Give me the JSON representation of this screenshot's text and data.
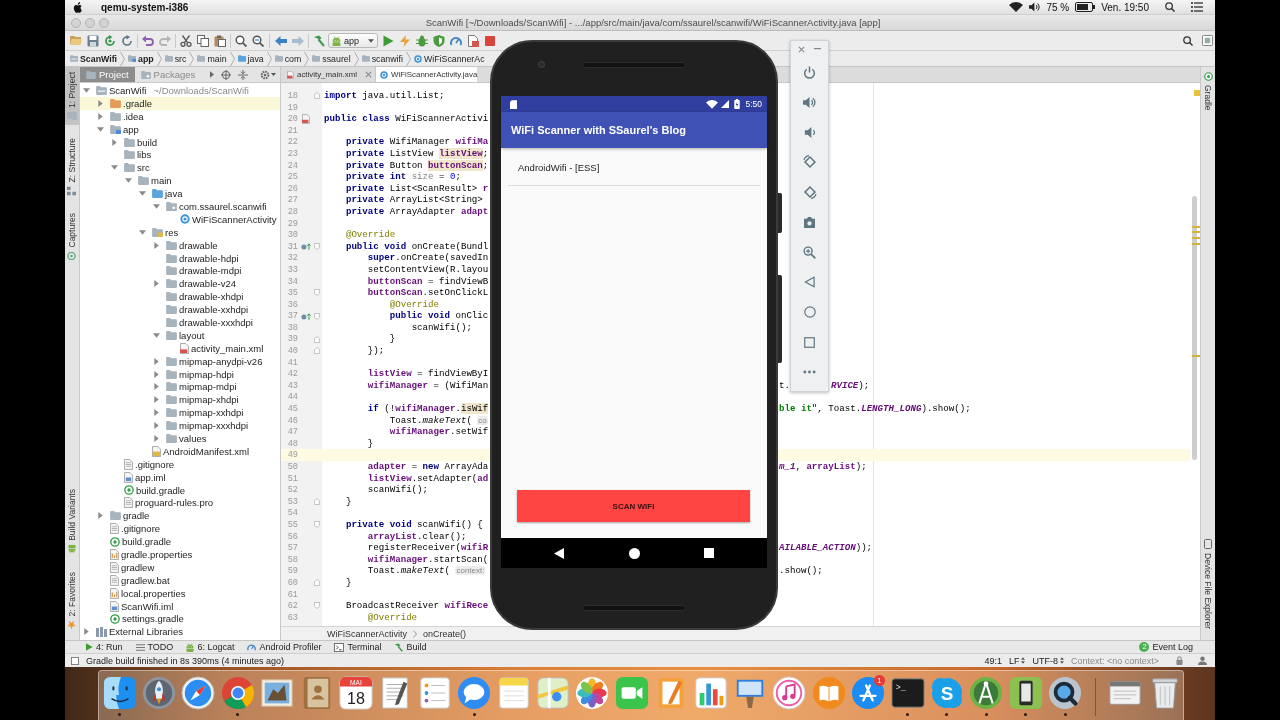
{
  "menubar": {
    "app_name": "qemu-system-i386",
    "battery": "75 %",
    "clock": "Ven. 19:50"
  },
  "window": {
    "title": "ScanWifi [~/Downloads/ScanWifi] - .../app/src/main/java/com/ssaurel/scanwifi/WiFiScannerActivity.java [app]"
  },
  "toolbar": {
    "run_config": "app"
  },
  "navbar": [
    {
      "label": "ScanWifi",
      "kind": "project"
    },
    {
      "label": "app",
      "kind": "module"
    },
    {
      "label": "src",
      "kind": "folder"
    },
    {
      "label": "main",
      "kind": "folder"
    },
    {
      "label": "java",
      "kind": "source"
    },
    {
      "label": "com",
      "kind": "folder"
    },
    {
      "label": "ssaurel",
      "kind": "folder"
    },
    {
      "label": "scanwifi",
      "kind": "folder"
    },
    {
      "label": "WiFiScannerAc",
      "kind": "class"
    }
  ],
  "left_tool_windows": {
    "top": [
      {
        "label": "1: Project",
        "kind": "project",
        "selected": true
      },
      {
        "label": "Z: Structure",
        "kind": "structure",
        "selected": false
      },
      {
        "label": "Captures",
        "kind": "captures",
        "selected": false
      }
    ],
    "bottom": [
      {
        "label": "Build Variants",
        "kind": "variants",
        "selected": false
      },
      {
        "label": "2: Favorites",
        "kind": "favorites",
        "selected": false
      }
    ]
  },
  "project_panel": {
    "tabs": [
      {
        "label": "Project",
        "selected": true
      },
      {
        "label": "Packages",
        "selected": false
      }
    ],
    "tree": [
      {
        "name": "ScanWifi",
        "path": "~/Downloads/ScanWifi",
        "kind": "project",
        "expanded": true,
        "highlighted": false,
        "children": [
          {
            "name": ".gradle",
            "kind": "folder-excluded",
            "expanded": false,
            "highlighted": true
          },
          {
            "name": ".idea",
            "kind": "folder",
            "expanded": false,
            "highlighted": false
          },
          {
            "name": "app",
            "kind": "module",
            "expanded": true,
            "highlighted": false,
            "children": [
              {
                "name": "build",
                "kind": "folder",
                "expanded": false,
                "highlighted": false
              },
              {
                "name": "libs",
                "kind": "folder",
                "highlighted": false
              },
              {
                "name": "src",
                "kind": "folder",
                "expanded": true,
                "highlighted": false,
                "children": [
                  {
                    "name": "main",
                    "kind": "folder",
                    "expanded": true,
                    "highlighted": false,
                    "children": [
                      {
                        "name": "java",
                        "kind": "folder-source",
                        "expanded": true,
                        "highlighted": false,
                        "children": [
                          {
                            "name": "com.ssaurel.scanwifi",
                            "kind": "package",
                            "expanded": true,
                            "highlighted": false,
                            "children": [
                              {
                                "name": "WiFiScannerActivity",
                                "kind": "class",
                                "highlighted": false
                              }
                            ]
                          }
                        ]
                      },
                      {
                        "name": "res",
                        "kind": "folder-res",
                        "expanded": true,
                        "highlighted": false,
                        "children": [
                          {
                            "name": "drawable",
                            "kind": "folder",
                            "expanded": false,
                            "highlighted": false
                          },
                          {
                            "name": "drawable-hdpi",
                            "kind": "folder",
                            "highlighted": false
                          },
                          {
                            "name": "drawable-mdpi",
                            "kind": "folder",
                            "highlighted": false
                          },
                          {
                            "name": "drawable-v24",
                            "kind": "folder",
                            "expanded": false,
                            "highlighted": false
                          },
                          {
                            "name": "drawable-xhdpi",
                            "kind": "folder",
                            "highlighted": false
                          },
                          {
                            "name": "drawable-xxhdpi",
                            "kind": "folder",
                            "highlighted": false
                          },
                          {
                            "name": "drawable-xxxhdpi",
                            "kind": "folder",
                            "highlighted": false
                          },
                          {
                            "name": "layout",
                            "kind": "folder",
                            "expanded": true,
                            "highlighted": false,
                            "children": [
                              {
                                "name": "activity_main.xml",
                                "kind": "layout-xml",
                                "highlighted": false
                              }
                            ]
                          },
                          {
                            "name": "mipmap-anydpi-v26",
                            "kind": "folder",
                            "expanded": false,
                            "highlighted": false
                          },
                          {
                            "name": "mipmap-hdpi",
                            "kind": "folder",
                            "expanded": false,
                            "highlighted": false
                          },
                          {
                            "name": "mipmap-mdpi",
                            "kind": "folder",
                            "expanded": false,
                            "highlighted": false
                          },
                          {
                            "name": "mipmap-xhdpi",
                            "kind": "folder",
                            "expanded": false,
                            "highlighted": false
                          },
                          {
                            "name": "mipmap-xxhdpi",
                            "kind": "folder",
                            "expanded": false,
                            "highlighted": false
                          },
                          {
                            "name": "mipmap-xxxhdpi",
                            "kind": "folder",
                            "expanded": false,
                            "highlighted": false
                          },
                          {
                            "name": "values",
                            "kind": "folder",
                            "expanded": false,
                            "highlighted": false
                          }
                        ]
                      },
                      {
                        "name": "AndroidManifest.xml",
                        "kind": "manifest",
                        "highlighted": false
                      }
                    ]
                  }
                ]
              },
              {
                "name": ".gitignore",
                "kind": "text-file",
                "highlighted": false
              },
              {
                "name": "app.iml",
                "kind": "iml",
                "highlighted": false
              },
              {
                "name": "build.gradle",
                "kind": "gradle",
                "highlighted": false
              },
              {
                "name": "proguard-rules.pro",
                "kind": "text-file",
                "highlighted": false
              }
            ]
          },
          {
            "name": "gradle",
            "kind": "folder",
            "expanded": false,
            "highlighted": false
          },
          {
            "name": ".gitignore",
            "kind": "text-file",
            "highlighted": false
          },
          {
            "name": "build.gradle",
            "kind": "gradle",
            "highlighted": false
          },
          {
            "name": "gradle.properties",
            "kind": "properties",
            "highlighted": false
          },
          {
            "name": "gradlew",
            "kind": "text-file",
            "highlighted": false
          },
          {
            "name": "gradlew.bat",
            "kind": "text-file",
            "highlighted": false
          },
          {
            "name": "local.properties",
            "kind": "properties",
            "highlighted": false
          },
          {
            "name": "ScanWifi.iml",
            "kind": "iml",
            "highlighted": false
          },
          {
            "name": "settings.gradle",
            "kind": "gradle",
            "highlighted": false
          }
        ]
      },
      {
        "name": "External Libraries",
        "kind": "libraries",
        "expanded": false,
        "highlighted": false
      }
    ]
  },
  "editor": {
    "tabs": [
      {
        "label": "activity_main.xml",
        "kind": "xml",
        "selected": false,
        "close_icon": true
      },
      {
        "label": "WiFiScannerActivity.java",
        "kind": "class",
        "selected": true,
        "close_icon": false
      }
    ],
    "lines": [
      {
        "number": "18",
        "current": false,
        "fold": {
          "kind": "end"
        },
        "code": [
          {
            "kind": "keyword",
            "text": "import"
          },
          {
            "kind": "plain",
            "text": " java.util.List;"
          }
        ]
      },
      {
        "number": "19",
        "current": false
      },
      {
        "number": "20",
        "current": false,
        "gutter": {
          "kind": "layout"
        },
        "code": [
          {
            "kind": "keyword",
            "text": "public class"
          },
          {
            "kind": "plain",
            "text": " WiFiScannerActivi"
          }
        ]
      },
      {
        "number": "21",
        "current": false
      },
      {
        "number": "22",
        "current": false,
        "code": [
          {
            "kind": "keyword",
            "text": "    private"
          },
          {
            "kind": "plain",
            "text": " WifiManager "
          },
          {
            "kind": "field",
            "text": "wifiMa"
          }
        ]
      },
      {
        "number": "23",
        "current": false,
        "code": [
          {
            "kind": "keyword",
            "text": "    private"
          },
          {
            "kind": "plain",
            "text": " ListView "
          },
          {
            "kind": "field-hl",
            "text": "listView"
          },
          {
            "kind": "plain",
            "text": ";"
          }
        ]
      },
      {
        "number": "24",
        "current": false,
        "code": [
          {
            "kind": "keyword",
            "text": "    private"
          },
          {
            "kind": "plain",
            "text": " Button "
          },
          {
            "kind": "field-hl",
            "text": "buttonScan"
          },
          {
            "kind": "plain",
            "text": ";"
          }
        ]
      },
      {
        "number": "25",
        "current": false,
        "code": [
          {
            "kind": "keyword",
            "text": "    private int "
          },
          {
            "kind": "unused",
            "text": "size"
          },
          {
            "kind": "plain",
            "text": " = "
          },
          {
            "kind": "number",
            "text": "0"
          },
          {
            "kind": "plain",
            "text": ";"
          }
        ]
      },
      {
        "number": "26",
        "current": false,
        "code": [
          {
            "kind": "keyword",
            "text": "    private"
          },
          {
            "kind": "plain",
            "text": " List<ScanResult> "
          },
          {
            "kind": "field",
            "text": "r"
          }
        ]
      },
      {
        "number": "27",
        "current": false,
        "code": [
          {
            "kind": "keyword",
            "text": "    private"
          },
          {
            "kind": "plain",
            "text": " ArrayList<String>"
          }
        ]
      },
      {
        "number": "28",
        "current": false,
        "code": [
          {
            "kind": "keyword",
            "text": "    private"
          },
          {
            "kind": "plain",
            "text": " ArrayAdapter "
          },
          {
            "kind": "field",
            "text": "adapt"
          }
        ]
      },
      {
        "number": "29",
        "current": false
      },
      {
        "number": "30",
        "current": false,
        "code": [
          {
            "kind": "annotation",
            "text": "    @Override"
          }
        ]
      },
      {
        "number": "31",
        "current": false,
        "gutter": {
          "kind": "override"
        },
        "fold": {
          "kind": "start"
        },
        "code": [
          {
            "kind": "keyword",
            "text": "    public void"
          },
          {
            "kind": "plain",
            "text": " onCreate(Bundl"
          }
        ]
      },
      {
        "number": "32",
        "current": false,
        "code": [
          {
            "kind": "keyword",
            "text": "        super"
          },
          {
            "kind": "plain",
            "text": ".onCreate(savedIn"
          }
        ]
      },
      {
        "number": "33",
        "current": false,
        "code": [
          {
            "kind": "plain",
            "text": "        setContentView(R.layou"
          }
        ]
      },
      {
        "number": "34",
        "current": false,
        "code": [
          {
            "kind": "field",
            "text": "        buttonScan"
          },
          {
            "kind": "plain",
            "text": " = findViewB"
          }
        ]
      },
      {
        "number": "35",
        "current": false,
        "fold": {
          "kind": "start"
        },
        "code": [
          {
            "kind": "field",
            "text": "        buttonScan"
          },
          {
            "kind": "plain",
            "text": ".setOnClickL"
          }
        ]
      },
      {
        "number": "36",
        "current": false,
        "code": [
          {
            "kind": "annotation",
            "text": "            @Override"
          }
        ]
      },
      {
        "number": "37",
        "current": false,
        "gutter": {
          "kind": "override"
        },
        "fold": {
          "kind": "start"
        },
        "code": [
          {
            "kind": "keyword",
            "text": "            public void"
          },
          {
            "kind": "plain",
            "text": " onClic"
          }
        ]
      },
      {
        "number": "38",
        "current": false,
        "code": [
          {
            "kind": "plain",
            "text": "                scanWifi();"
          }
        ]
      },
      {
        "number": "39",
        "current": false,
        "fold": {
          "kind": "end"
        },
        "code": [
          {
            "kind": "plain",
            "text": "            }"
          }
        ]
      },
      {
        "number": "40",
        "current": false,
        "fold": {
          "kind": "end"
        },
        "code": [
          {
            "kind": "plain",
            "text": "        });"
          }
        ]
      },
      {
        "number": "41",
        "current": false
      },
      {
        "number": "42",
        "current": false,
        "code": [
          {
            "kind": "field",
            "text": "        listView"
          },
          {
            "kind": "plain",
            "text": " = findViewByI"
          }
        ]
      },
      {
        "number": "43",
        "current": false,
        "code": [
          {
            "kind": "field",
            "text": "        wifiManager"
          },
          {
            "kind": "plain",
            "text": " = (WifiMan"
          }
        ],
        "right": [
          {
            "code": [
              {
                "kind": "plain",
                "text": "t."
              }
            ]
          },
          {
            "code": [
              {
                "kind": "constant",
                "text": "RVICE"
              },
              {
                "kind": "plain",
                "text": ");"
              }
            ]
          }
        ]
      },
      {
        "number": "44",
        "current": false
      },
      {
        "number": "45",
        "current": false,
        "code": [
          {
            "kind": "keyword",
            "text": "        if"
          },
          {
            "kind": "plain",
            "text": " (!"
          },
          {
            "kind": "field",
            "text": "wifiManager"
          },
          {
            "kind": "plain",
            "text": "."
          },
          {
            "kind": "method-hl",
            "text": "isWif"
          }
        ],
        "right": [
          {
            "code": [
              {
                "kind": "string",
                "text": "ble it\""
              },
              {
                "kind": "plain",
                "text": ", Toast."
              },
              {
                "kind": "constant",
                "text": "LENGTH_LONG"
              },
              {
                "kind": "plain",
                "text": ").show();"
              }
            ]
          }
        ]
      },
      {
        "number": "46",
        "current": false,
        "code": [
          {
            "kind": "plain",
            "text": "            Toast."
          },
          {
            "kind": "italic",
            "text": "makeText"
          },
          {
            "kind": "plain",
            "text": "( "
          },
          {
            "kind": "hint",
            "text": "co"
          }
        ]
      },
      {
        "number": "47",
        "current": false,
        "code": [
          {
            "kind": "field",
            "text": "            wifiManager"
          },
          {
            "kind": "plain",
            "text": ".setWif"
          }
        ]
      },
      {
        "number": "48",
        "current": false,
        "code": [
          {
            "kind": "plain",
            "text": "        }"
          }
        ]
      },
      {
        "number": "49",
        "current": true
      },
      {
        "number": "50",
        "current": false,
        "code": [
          {
            "kind": "field",
            "text": "        adapter"
          },
          {
            "kind": "plain",
            "text": " = "
          },
          {
            "kind": "keyword",
            "text": "new"
          },
          {
            "kind": "plain",
            "text": " ArrayAda"
          }
        ],
        "right": [
          {
            "code": [
              {
                "kind": "constant",
                "text": "m_1"
              },
              {
                "kind": "plain",
                "text": ", "
              },
              {
                "kind": "field",
                "text": "arrayList"
              },
              {
                "kind": "plain",
                "text": ");"
              }
            ]
          }
        ]
      },
      {
        "number": "51",
        "current": false,
        "code": [
          {
            "kind": "field",
            "text": "        listView"
          },
          {
            "kind": "plain",
            "text": ".setAdapter("
          },
          {
            "kind": "field",
            "text": "ad"
          }
        ]
      },
      {
        "number": "52",
        "current": false,
        "code": [
          {
            "kind": "plain",
            "text": "        scanWifi();"
          }
        ]
      },
      {
        "number": "53",
        "current": false,
        "fold": {
          "kind": "end"
        },
        "code": [
          {
            "kind": "plain",
            "text": "    }"
          }
        ]
      },
      {
        "number": "54",
        "current": false
      },
      {
        "number": "55",
        "current": false,
        "fold": {
          "kind": "start"
        },
        "code": [
          {
            "kind": "keyword",
            "text": "    private void"
          },
          {
            "kind": "plain",
            "text": " scanWifi() {"
          }
        ]
      },
      {
        "number": "56",
        "current": false,
        "code": [
          {
            "kind": "field",
            "text": "        arrayList"
          },
          {
            "kind": "plain",
            "text": ".clear();"
          }
        ]
      },
      {
        "number": "57",
        "current": false,
        "code": [
          {
            "kind": "plain",
            "text": "        registerReceiver("
          },
          {
            "kind": "field",
            "text": "wifiR"
          }
        ],
        "right": [
          {
            "code": [
              {
                "kind": "constant",
                "text": "AILABLE_ACTION"
              },
              {
                "kind": "plain",
                "text": "));"
              }
            ]
          }
        ]
      },
      {
        "number": "58",
        "current": false,
        "code": [
          {
            "kind": "field",
            "text": "        wifiManager"
          },
          {
            "kind": "plain",
            "text": ".startScan("
          }
        ]
      },
      {
        "number": "59",
        "current": false,
        "code": [
          {
            "kind": "plain",
            "text": "        Toast."
          },
          {
            "kind": "italic",
            "text": "makeText"
          },
          {
            "kind": "plain",
            "text": "( "
          },
          {
            "kind": "hint",
            "text": "context:"
          }
        ],
        "right": [
          {
            "code": [
              {
                "kind": "plain",
                "text": ".show();"
              }
            ]
          }
        ]
      },
      {
        "number": "60",
        "current": false,
        "fold": {
          "kind": "end"
        },
        "code": [
          {
            "kind": "plain",
            "text": "    }"
          }
        ]
      },
      {
        "number": "61",
        "current": false
      },
      {
        "number": "62",
        "current": false,
        "fold": {
          "kind": "start"
        },
        "code": [
          {
            "kind": "plain",
            "text": "    BroadcastReceiver "
          },
          {
            "kind": "field",
            "text": "wifiRece"
          }
        ]
      },
      {
        "number": "63",
        "current": false,
        "code": [
          {
            "kind": "annotation",
            "text": "        @Override"
          }
        ]
      }
    ],
    "breadcrumbs": [
      "WiFiScannerActivity",
      "onCreate()"
    ]
  },
  "right_tool_windows": {
    "top": [
      {
        "label": "Gradle",
        "kind": "gradle"
      }
    ],
    "bottom": [
      {
        "label": "Device File Explorer",
        "kind": "device"
      }
    ]
  },
  "bottom_tool_windows": [
    {
      "label": "4: Run",
      "kind": "run"
    },
    {
      "label": "TODO",
      "kind": "todo"
    },
    {
      "label": "6: Logcat",
      "kind": "logcat"
    },
    {
      "label": "Android Profiler",
      "kind": "profiler"
    },
    {
      "label": "Terminal",
      "kind": "terminal"
    },
    {
      "label": "Build",
      "kind": "build"
    }
  ],
  "event_log": {
    "label": "Event Log",
    "count": "2"
  },
  "status_bar": {
    "message": "Gradle build finished in 8s 390ms (4 minutes ago)",
    "position": "49:1",
    "line_separator": "LF",
    "encoding": "UTF-8",
    "context": "Context: <no context>"
  },
  "emulator": {
    "time": "5:50",
    "app_title": "WiFi Scanner with SSaurel's Blog",
    "networks": [
      "AndroidWifi - [ESS]"
    ],
    "button": "SCAN WIFI"
  },
  "dock": {
    "apps": [
      {
        "kind": "finder",
        "running": true
      },
      {
        "kind": "launchpad",
        "running": false
      },
      {
        "kind": "safari",
        "running": false
      },
      {
        "kind": "chrome",
        "running": true
      },
      {
        "kind": "mail",
        "running": false
      },
      {
        "kind": "contacts",
        "running": false
      },
      {
        "kind": "calendar",
        "month": "MAI",
        "day": "18",
        "running": false
      },
      {
        "kind": "textedit",
        "running": false
      },
      {
        "kind": "reminders",
        "running": false
      },
      {
        "kind": "messages",
        "running": true
      },
      {
        "kind": "notes",
        "running": false
      },
      {
        "kind": "maps",
        "running": false
      },
      {
        "kind": "photos",
        "running": false
      },
      {
        "kind": "facetime",
        "running": false
      },
      {
        "kind": "pages",
        "running": false
      },
      {
        "kind": "numbers",
        "running": false
      },
      {
        "kind": "keynote",
        "running": false
      },
      {
        "kind": "itunes",
        "running": false
      },
      {
        "kind": "ibooks",
        "running": false
      },
      {
        "kind": "appstore",
        "badge": "1",
        "running": false
      },
      {
        "kind": "terminal",
        "glyph": ">_",
        "running": true
      },
      {
        "kind": "skype",
        "glyph": "S",
        "running": true
      },
      {
        "kind": "androidstudio",
        "running": true
      },
      {
        "kind": "device",
        "running": true
      },
      {
        "kind": "quicktime",
        "running": true
      }
    ],
    "stacks": [
      {
        "kind": "window",
        "running": false
      },
      {
        "kind": "trash",
        "running": false
      }
    ]
  }
}
